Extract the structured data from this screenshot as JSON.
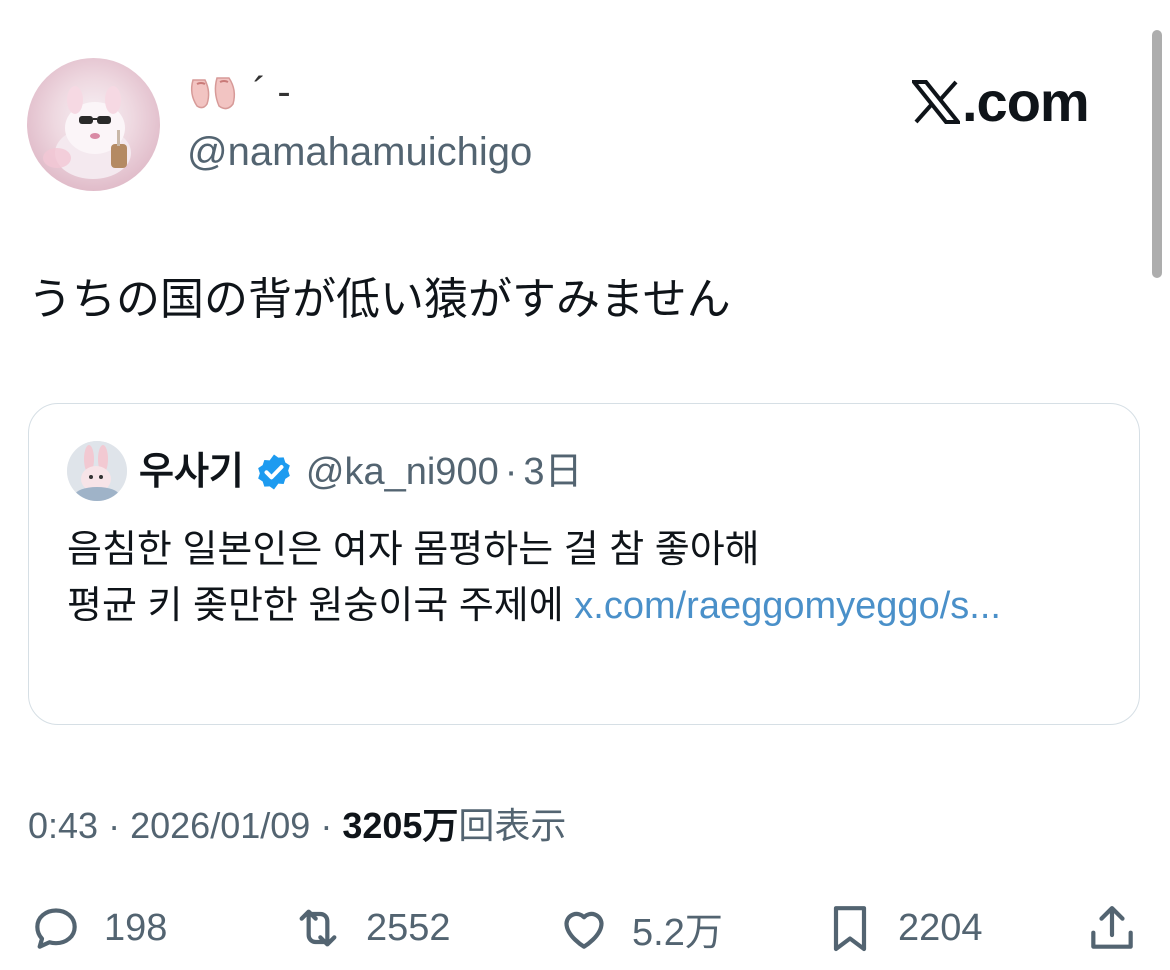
{
  "author": {
    "display_name": "´ -",
    "handle": "@namahamuichigo",
    "avatar_icon": "pink-bear-avatar",
    "name_emoji_icon": "ballet-shoes-icon"
  },
  "brand": {
    "logo_text": ".com",
    "logo_icon": "x-logo-icon"
  },
  "tweet": {
    "text": "うちの国の背が低い猿がすみません"
  },
  "quote": {
    "name": "우사기",
    "verified_icon": "verified-badge-icon",
    "handle": "@ka_ni900",
    "separator": "·",
    "time": "3日",
    "line1": "음침한 일본인은 여자 몸평하는 걸 참 좋아해",
    "line2": "평균 키 좆만한 원숭이국 주제에 ",
    "link": "x.com/raeggomyeggo/s..."
  },
  "meta": {
    "time": "0:43",
    "date": "2026/01/09",
    "sep": "·",
    "view_count": "3205万",
    "view_label": "回表示"
  },
  "actions": {
    "replies": "198",
    "reposts": "2552",
    "likes": "5.2万",
    "bookmarks": "2204"
  },
  "colors": {
    "text": "#0f1419",
    "secondary": "#536471",
    "link": "#4a90c9",
    "verified": "#1d9bf0",
    "border": "#d6dfe5"
  }
}
